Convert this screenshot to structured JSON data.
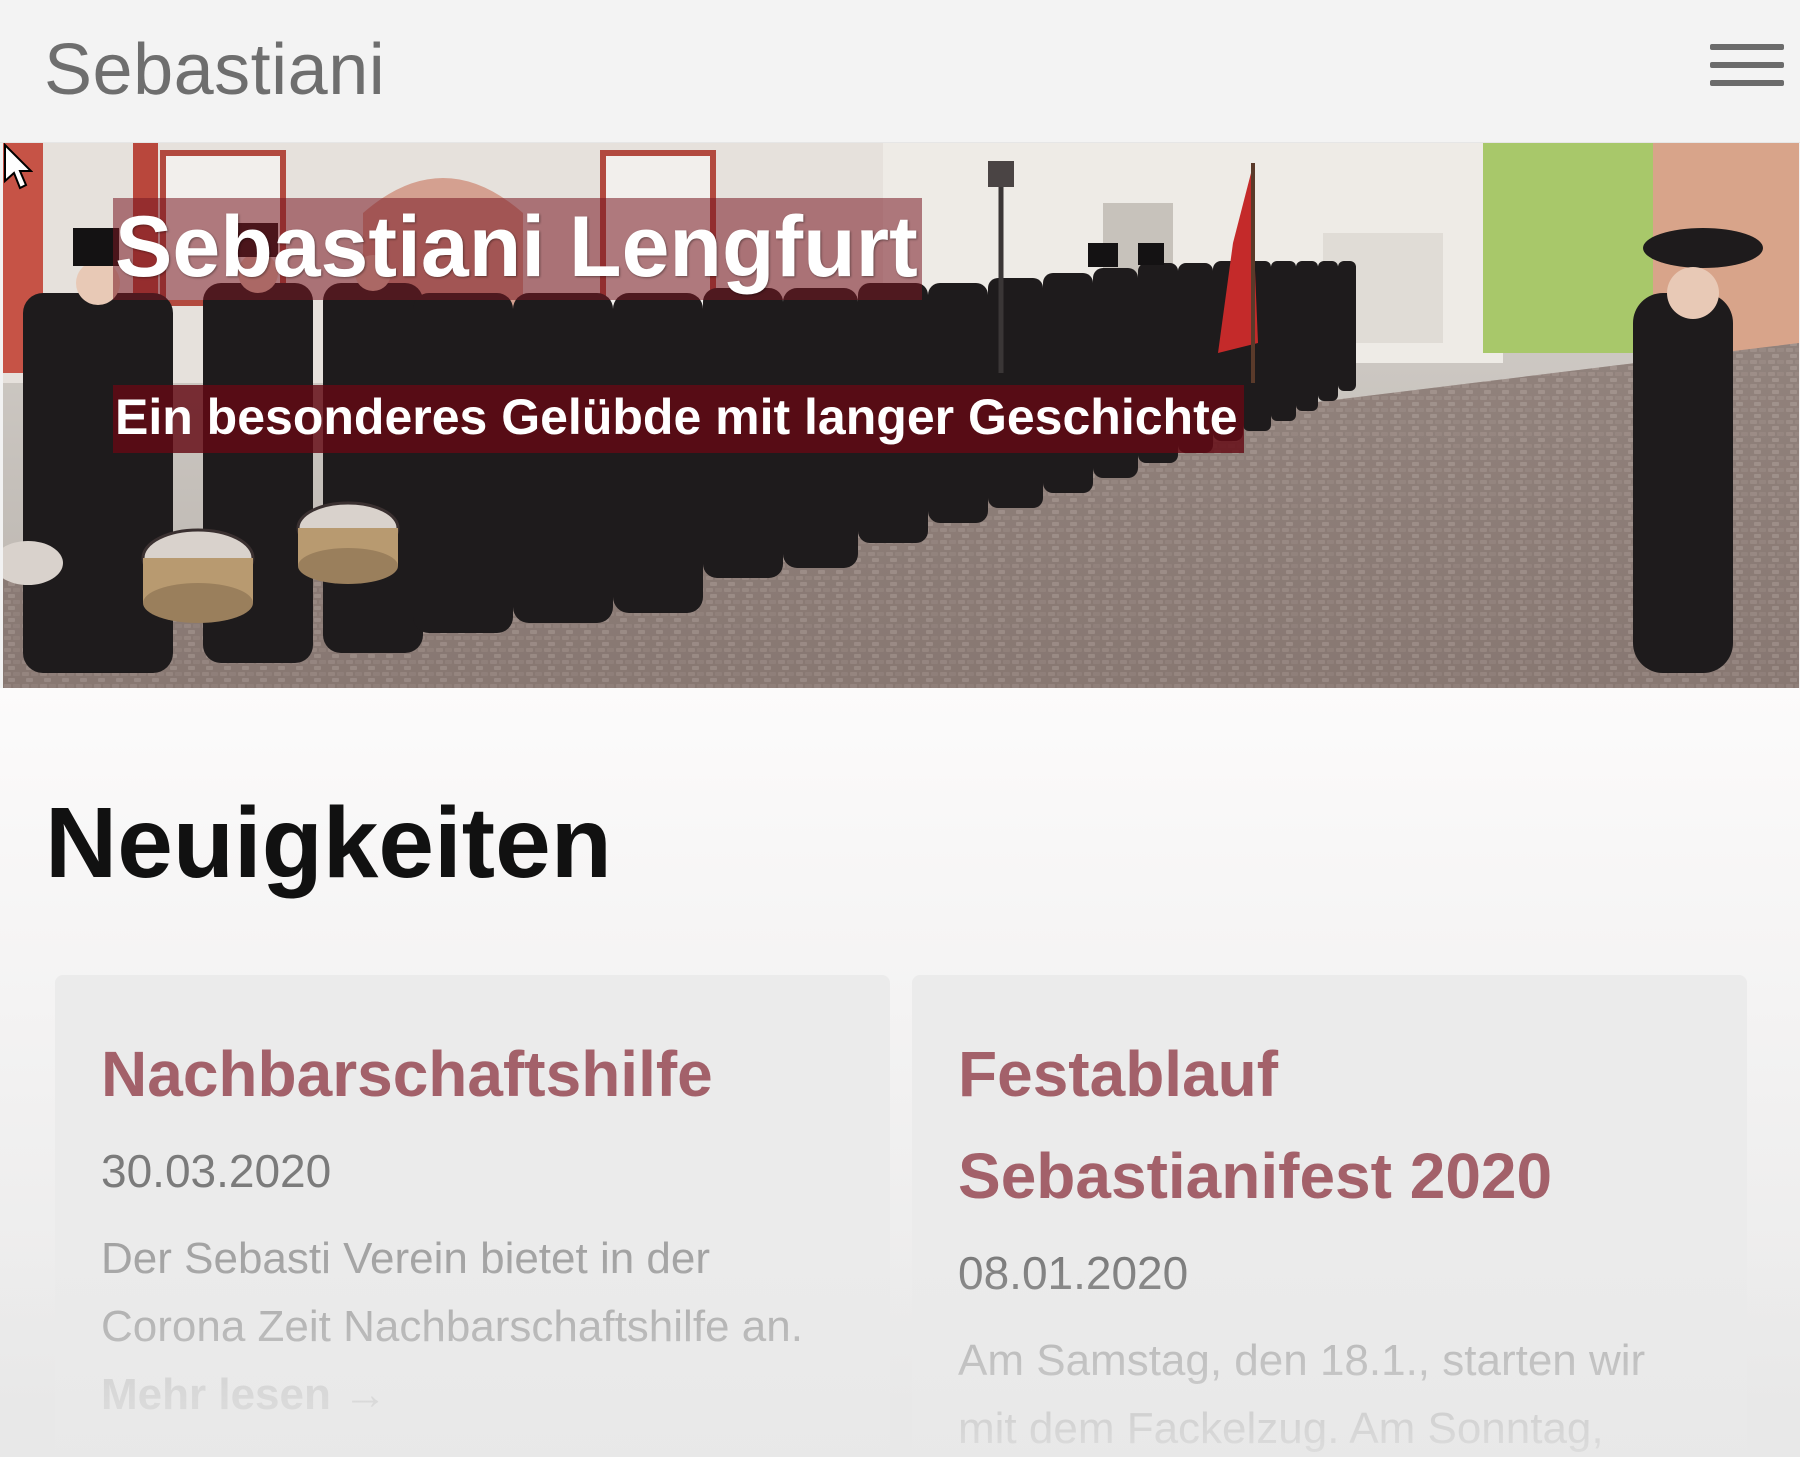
{
  "header": {
    "brand": "Sebastiani",
    "menu_icon": "hamburger-menu-icon"
  },
  "hero": {
    "title": "Sebastiani Lengfurt",
    "subtitle": "Ein besonderes Gelübde mit langer Geschichte"
  },
  "news": {
    "heading": "Neuigkeiten",
    "items": [
      {
        "title": "Nachbarschaftshilfe",
        "date": "30.03.2020",
        "excerpt": "Der Sebasti Verein bietet in der Corona Zeit Nachbarschaftshilfe an.",
        "more": "Mehr lesen →"
      },
      {
        "title": "Festablauf Sebastianifest 2020",
        "date": "08.01.2020",
        "excerpt": "Am Samstag, den 18.1., starten wir mit dem Fackelzug. Am Sonntag,"
      }
    ]
  },
  "colors": {
    "accent": "#a3616a",
    "hero_overlay": "#7a1824",
    "header_bg": "#f3f3f3"
  }
}
